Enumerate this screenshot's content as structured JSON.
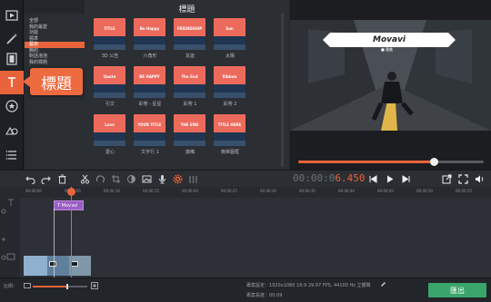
{
  "tools": [
    {
      "name": "import-media-icon"
    },
    {
      "name": "magic-wand-icon"
    },
    {
      "name": "film-strip-icon"
    },
    {
      "name": "titles-icon"
    },
    {
      "name": "star-stickers-icon"
    },
    {
      "name": "shapes-icon"
    },
    {
      "name": "more-menu-icon"
    }
  ],
  "callout": "標題",
  "categories": [
    "全部",
    "我的最愛",
    "功能",
    "標準",
    "藝術",
    "簡約",
    "對話泡泡",
    "我的標題"
  ],
  "selected_category": 4,
  "gallery": {
    "title": "標題",
    "items": [
      {
        "label": "3D 公告",
        "thumb": "TITLE"
      },
      {
        "label": "六角形",
        "thumb": "Be Happy"
      },
      {
        "label": "友誼",
        "thumb": "FRIENDSHIP"
      },
      {
        "label": "太陽",
        "thumb": "Sun"
      },
      {
        "label": "引文",
        "thumb": "Quote"
      },
      {
        "label": "彩帶 - 星星",
        "thumb": "BE HAPPY"
      },
      {
        "label": "彩帶 1",
        "thumb": "The End"
      },
      {
        "label": "彩帶 2",
        "thumb": "Ribbon"
      },
      {
        "label": "愛心",
        "thumb": "Love"
      },
      {
        "label": "文字行 1",
        "thumb": "YOUR TITLE"
      },
      {
        "label": "旗幟",
        "thumb": "THE END"
      },
      {
        "label": "簡單圓框",
        "thumb": "TITLE HERE"
      }
    ]
  },
  "preview": {
    "banner_title": "Movavi",
    "banner_sub": "■ 雅美"
  },
  "timecode": {
    "dim": "00:00:0",
    "hot": "6.450"
  },
  "playback_progress": 0.73,
  "ruler_ticks": [
    "00:00:00",
    "00:00:05",
    "00:00:10",
    "00:00:15",
    "00:00:20",
    "00:00:25",
    "00:00:30",
    "00:00:35",
    "00:00:40",
    "00:00:45",
    "00:00:50",
    "00:00:55"
  ],
  "timeline": {
    "title_clip": "Movavi"
  },
  "status": {
    "zoom_label": "比例：",
    "zoom_level": 0.62,
    "project_settings_label": "專案設定：",
    "project_settings": "1920x1080 16:9 29.97 FPS, 44100 Hz 立體聲",
    "project_length_label": "專案長度：",
    "project_length": "00:09",
    "export_label": "匯出"
  },
  "colors": {
    "accent": "#e8633b",
    "export": "#3aa56a",
    "title_clip": "#9a5ec2"
  }
}
